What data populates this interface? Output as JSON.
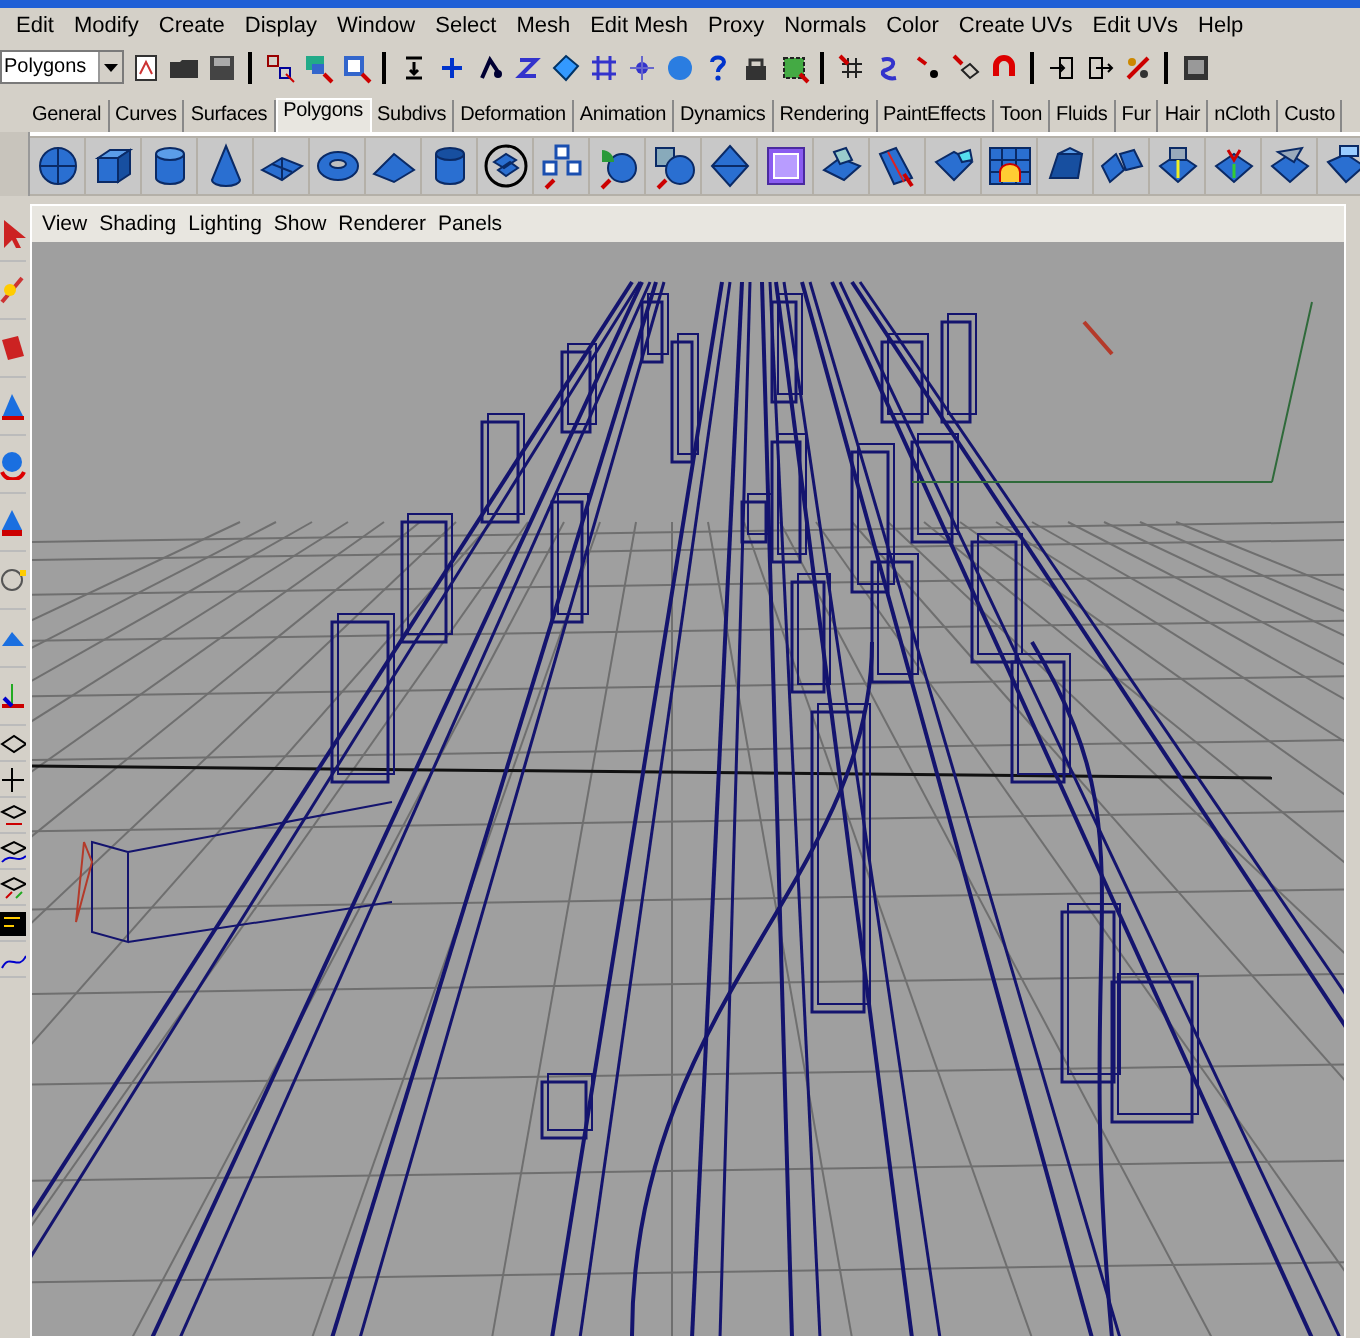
{
  "menu_bar": [
    "Edit",
    "Modify",
    "Create",
    "Display",
    "Window",
    "Select",
    "Mesh",
    "Edit Mesh",
    "Proxy",
    "Normals",
    "Color",
    "Create UVs",
    "Edit UVs",
    "Help"
  ],
  "menu_set": {
    "value": "Polygons"
  },
  "shelf_tabs": [
    {
      "label": "General",
      "selected": false
    },
    {
      "label": "Curves",
      "selected": false
    },
    {
      "label": "Surfaces",
      "selected": false
    },
    {
      "label": "Polygons",
      "selected": true
    },
    {
      "label": "Subdivs",
      "selected": false
    },
    {
      "label": "Deformation",
      "selected": false
    },
    {
      "label": "Animation",
      "selected": false
    },
    {
      "label": "Dynamics",
      "selected": false
    },
    {
      "label": "Rendering",
      "selected": false
    },
    {
      "label": "PaintEffects",
      "selected": false
    },
    {
      "label": "Toon",
      "selected": false
    },
    {
      "label": "Fluids",
      "selected": false
    },
    {
      "label": "Fur",
      "selected": false
    },
    {
      "label": "Hair",
      "selected": false
    },
    {
      "label": "nCloth",
      "selected": false
    },
    {
      "label": "Custo",
      "selected": false
    }
  ],
  "panel_menu": [
    "View",
    "Shading",
    "Lighting",
    "Show",
    "Renderer",
    "Panels"
  ]
}
